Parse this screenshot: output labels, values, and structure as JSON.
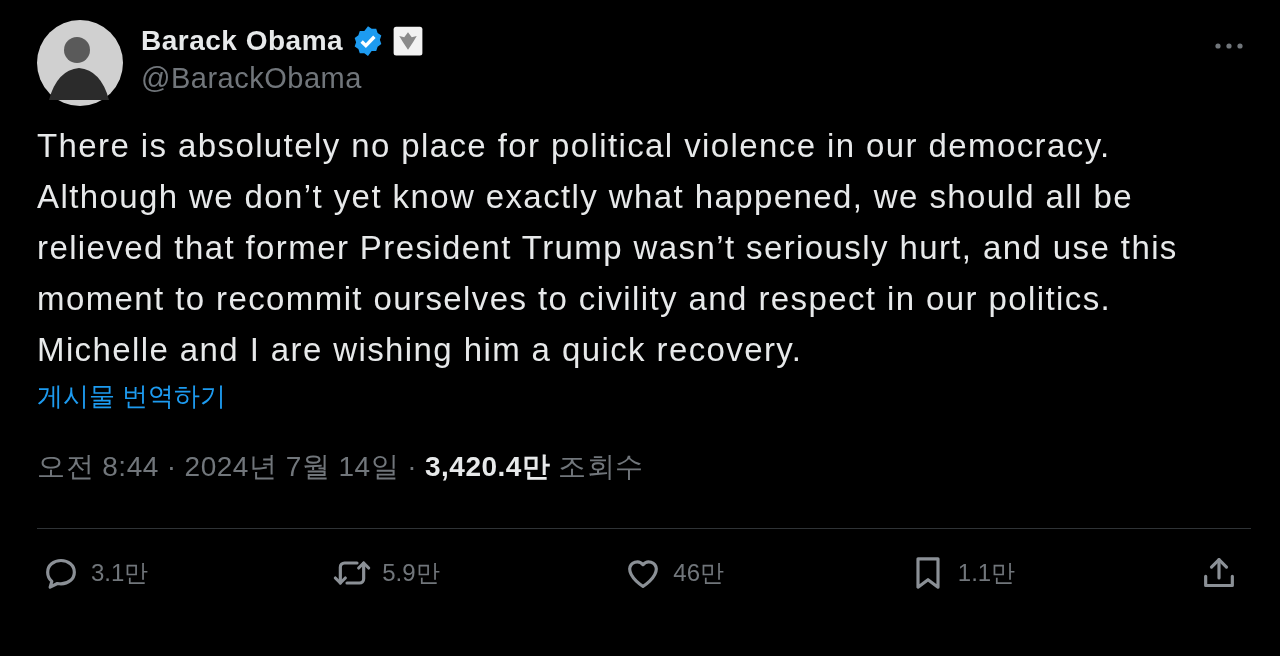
{
  "author": {
    "name": "Barack Obama",
    "verified": true,
    "handle": "@BarackObama"
  },
  "text": "There is absolutely no place for political violence in our democracy. Although we don’t yet know exactly what happened, we should all be relieved that former President Trump wasn’t seriously hurt, and use this moment to recommit ourselves to civility and respect in our politics. Michelle and I are wishing him a quick recovery.",
  "translate_link": "게시물 번역하기",
  "meta": {
    "time": "오전 8:44",
    "separator_1": "·",
    "date": "2024년 7월 14일",
    "separator_2": "·",
    "views": "3,420.4만",
    "views_label": "조회수"
  },
  "actions": [
    {
      "kind": "reply",
      "count": "3.1만"
    },
    {
      "kind": "repost",
      "count": "5.9만"
    },
    {
      "kind": "like",
      "count": "46만"
    },
    {
      "kind": "bookmark",
      "count": "1.1만"
    },
    {
      "kind": "share"
    }
  ]
}
